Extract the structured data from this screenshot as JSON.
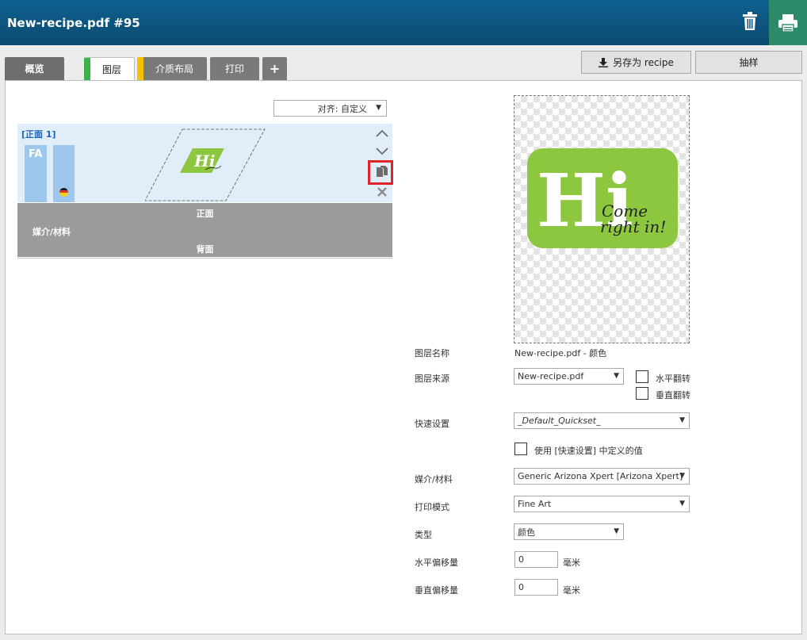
{
  "header": {
    "title": "New-recipe.pdf #95"
  },
  "tabs": [
    {
      "label": "概览"
    },
    {
      "label": "图层"
    },
    {
      "label": "介质布局"
    },
    {
      "label": "打印"
    },
    {
      "label": "+"
    }
  ],
  "actions": {
    "save_recipe": "另存为 recipe",
    "sample": "抽样"
  },
  "align": {
    "value": "对齐: 自定义"
  },
  "layer": {
    "label": "[正面 1]",
    "fa": "FA",
    "thumb_text": "Hi"
  },
  "media_block": {
    "front": "正面",
    "media": "媒介/材料",
    "back": "背面"
  },
  "preview": {
    "big": "Hi",
    "script1": "Come",
    "script2": "right in!"
  },
  "form": {
    "layer_name_label": "图层名称",
    "layer_name_value": "New-recipe.pdf - 颜色",
    "layer_source_label": "图层来源",
    "layer_source_value": "New-recipe.pdf",
    "flip_h": "水平翻转",
    "flip_v": "垂直翻转",
    "quickset_label": "快速设置",
    "quickset_value": "_Default_Quickset_",
    "use_quickset": "使用 [快速设置] 中定义的值",
    "media_label": "媒介/材料",
    "media_value": "Generic Arizona Xpert [Arizona Xpert]",
    "print_mode_label": "打印模式",
    "print_mode_value": "Fine Art",
    "type_label": "类型",
    "type_value": "颜色",
    "h_offset_label": "水平偏移量",
    "h_offset_value": "0",
    "v_offset_label": "垂直偏移量",
    "v_offset_value": "0",
    "unit": "毫米"
  },
  "icons": [
    "trash-icon",
    "printer-icon",
    "download-icon",
    "chevron-up-icon",
    "chevron-down-icon",
    "duplicate-icon",
    "close-icon",
    "caret-down-icon"
  ],
  "colors": {
    "header": "#0f6190",
    "print_button": "#2d8a69",
    "layers_tab_stripe": "#3bb24a",
    "media_tab_stripe": "#f2c200",
    "layer_row": "#e1eef9",
    "layer_bar": "#9dc7ed",
    "media_block": "#9b9b9b",
    "logo_green": "#8dc63f",
    "highlight": "#e0232a"
  }
}
